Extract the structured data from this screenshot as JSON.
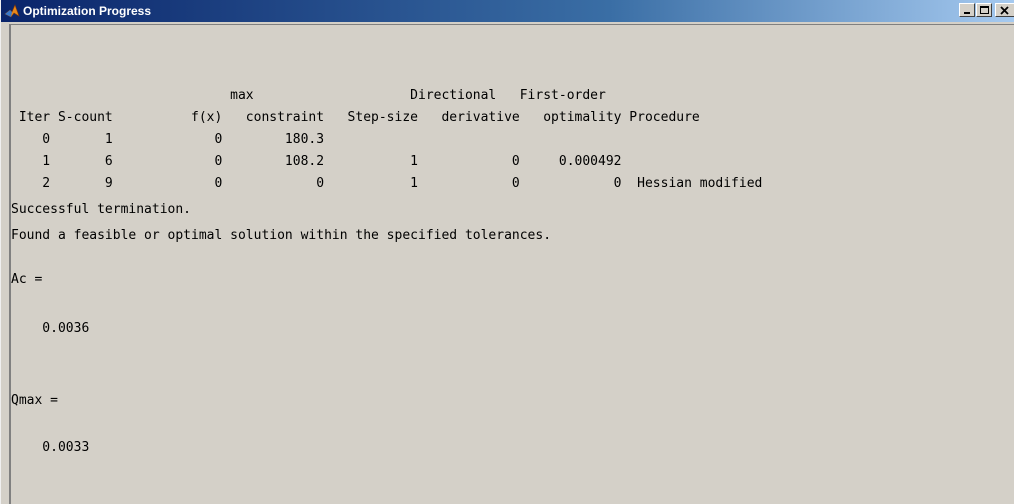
{
  "window": {
    "title": "Optimization Progress",
    "icon": "matlab-logo-icon",
    "controls": [
      "minimize-icon",
      "maximize-icon",
      "close-icon"
    ],
    "colors": {
      "titlebar_start": "#0a246a",
      "titlebar_end": "#a6caf0",
      "background": "#d4d0c8"
    }
  },
  "console": {
    "header_line_1": "                            max                    Directional   First-order",
    "header_line_2": " Iter S-count          f(x)   constraint   Step-size   derivative   optimality Procedure",
    "rows": [
      "    0       1             0        180.3",
      "    1       6             0        108.2           1            0     0.000492",
      "    2       9             0            0           1            0            0  Hessian modified"
    ],
    "termination": "Successful termination.",
    "found": "Found a feasible or optimal solution within the specified tolerances.",
    "ac_label": "Ac =",
    "ac_value": "    0.0036",
    "qmax_label": "Qmax =",
    "qmax_value": "    0.0033"
  }
}
